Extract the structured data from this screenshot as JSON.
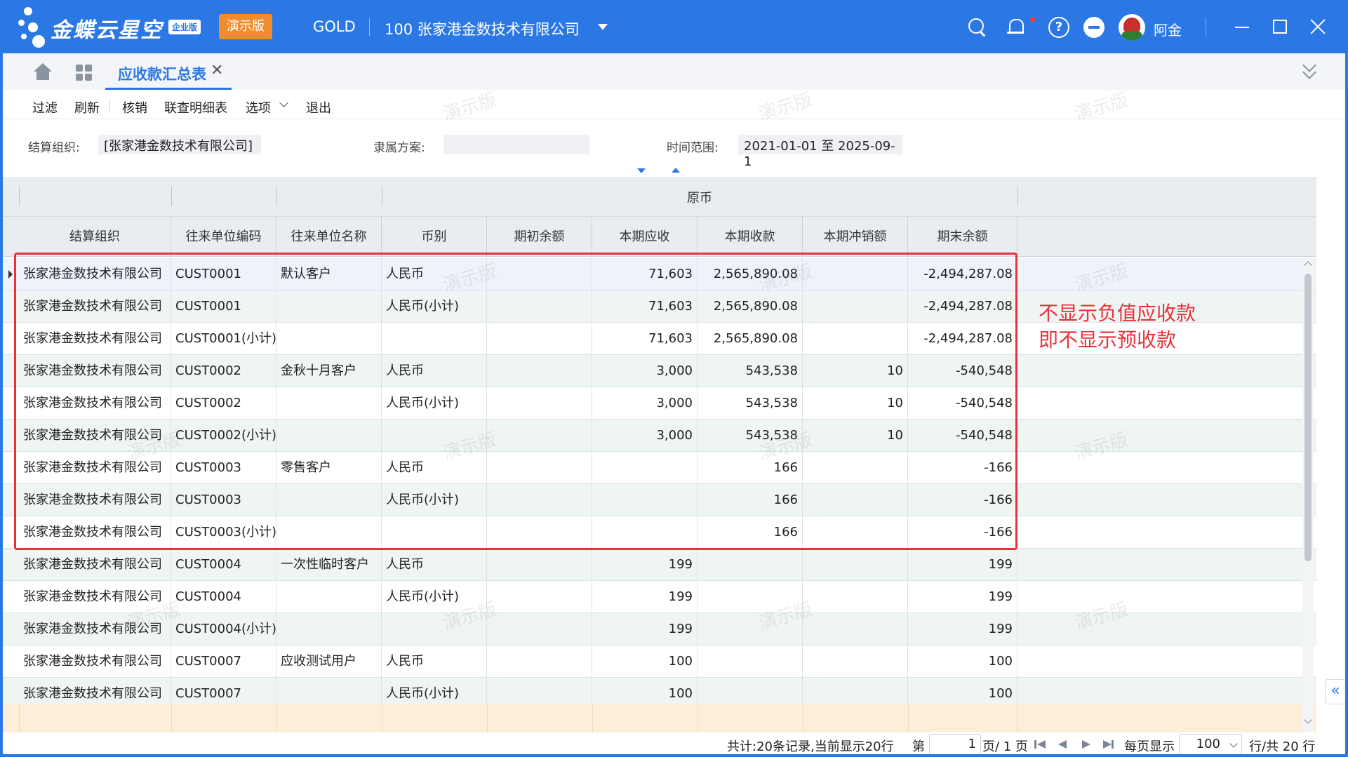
{
  "app": {
    "brand": "金蝶云星空",
    "edition_badge": "企业版",
    "demo_badge": "演示版",
    "org_code": "GOLD",
    "org_name": "100  张家港金数技术有限公司",
    "username": "阿金",
    "accent_color": "#2b78e4",
    "icons": [
      "search-icon",
      "bell-icon",
      "help-icon",
      "minus-circle-icon",
      "avatar"
    ]
  },
  "tabs": {
    "active_label": "应收款汇总表",
    "close_glyph": "✕"
  },
  "toolbar": {
    "filter": "过滤",
    "refresh": "刷新",
    "writeoff": "核销",
    "detail": "联查明细表",
    "options": "选项",
    "exit": "退出"
  },
  "filters": {
    "org_label": "结算组织:",
    "org_value": "[张家港金数技术有限公司]",
    "scheme_label": "隶属方案:",
    "scheme_value": "",
    "range_label": "时间范围:",
    "range_value": "2021-01-01 至 2025-09-1"
  },
  "grid": {
    "group_header": "原币",
    "columns": [
      "结算组织",
      "往来单位编码",
      "往来单位名称",
      "币别",
      "期初余额",
      "本期应收",
      "本期收款",
      "本期冲销额",
      "期末余额"
    ],
    "rows": [
      [
        "张家港金数技术有限公司",
        "CUST0001",
        "默认客户",
        "人民币",
        "",
        "71,603",
        "2,565,890.08",
        "",
        "-2,494,287.08"
      ],
      [
        "张家港金数技术有限公司",
        "CUST0001",
        "",
        "人民币(小计)",
        "",
        "71,603",
        "2,565,890.08",
        "",
        "-2,494,287.08"
      ],
      [
        "张家港金数技术有限公司",
        "CUST0001(小计)",
        "",
        "",
        "",
        "71,603",
        "2,565,890.08",
        "",
        "-2,494,287.08"
      ],
      [
        "张家港金数技术有限公司",
        "CUST0002",
        "金秋十月客户",
        "人民币",
        "",
        "3,000",
        "543,538",
        "10",
        "-540,548"
      ],
      [
        "张家港金数技术有限公司",
        "CUST0002",
        "",
        "人民币(小计)",
        "",
        "3,000",
        "543,538",
        "10",
        "-540,548"
      ],
      [
        "张家港金数技术有限公司",
        "CUST0002(小计)",
        "",
        "",
        "",
        "3,000",
        "543,538",
        "10",
        "-540,548"
      ],
      [
        "张家港金数技术有限公司",
        "CUST0003",
        "零售客户",
        "人民币",
        "",
        "",
        "166",
        "",
        "-166"
      ],
      [
        "张家港金数技术有限公司",
        "CUST0003",
        "",
        "人民币(小计)",
        "",
        "",
        "166",
        "",
        "-166"
      ],
      [
        "张家港金数技术有限公司",
        "CUST0003(小计)",
        "",
        "",
        "",
        "",
        "166",
        "",
        "-166"
      ],
      [
        "张家港金数技术有限公司",
        "CUST0004",
        "一次性临时客户",
        "人民币",
        "",
        "199",
        "",
        "",
        "199"
      ],
      [
        "张家港金数技术有限公司",
        "CUST0004",
        "",
        "人民币(小计)",
        "",
        "199",
        "",
        "",
        "199"
      ],
      [
        "张家港金数技术有限公司",
        "CUST0004(小计)",
        "",
        "",
        "",
        "199",
        "",
        "",
        "199"
      ],
      [
        "张家港金数技术有限公司",
        "CUST0007",
        "应收测试用户",
        "人民币",
        "",
        "100",
        "",
        "",
        "100"
      ],
      [
        "张家港金数技术有限公司",
        "CUST0007",
        "",
        "人民币(小计)",
        "",
        "100",
        "",
        "",
        "100"
      ]
    ]
  },
  "annotation": {
    "line1": "不显示负值应收款",
    "line2": "即不显示预收款",
    "color": "#e8323a"
  },
  "watermark": "演示版",
  "pager": {
    "summary": "共计:20条记录,当前显示20行",
    "page_prefix": "第",
    "page_value": "1",
    "page_suffix": "页/ 1 页",
    "per_page_label": "每页显示",
    "per_page_value": "100",
    "total_rows": "行/共 20 行"
  }
}
